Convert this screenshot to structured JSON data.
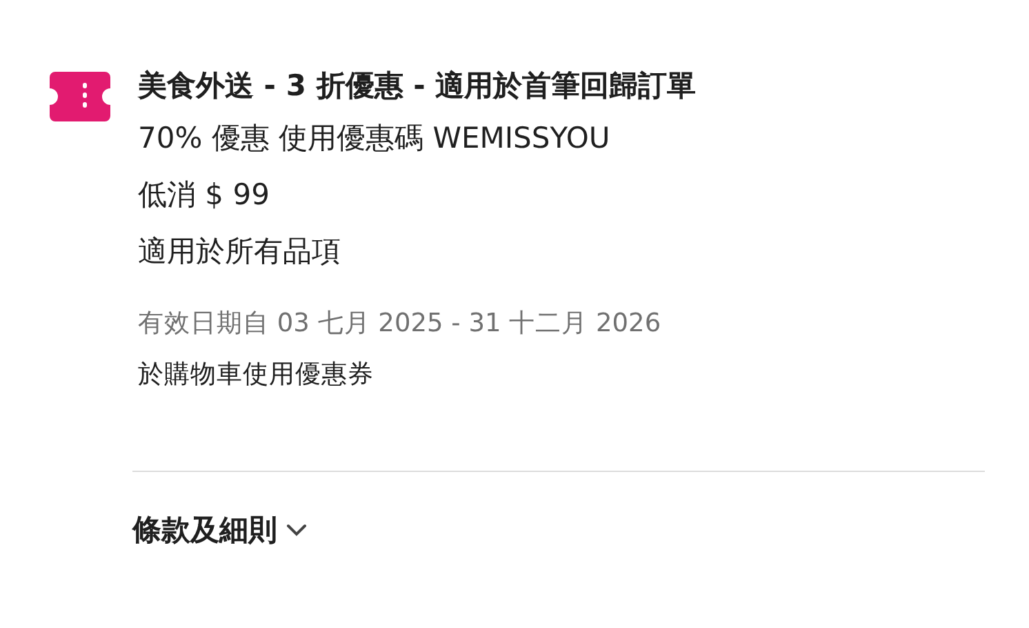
{
  "voucher": {
    "title": "美食外送 - 3 折優惠 - 適用於首筆回歸訂單",
    "details": [
      "70% 優惠 使用優惠碼 WEMISSYOU",
      "低消 $ 99",
      "適用於所有品項"
    ],
    "validity": "有效日期自 03 七月 2025 - 31 十二月 2026",
    "note": "於購物車使用優惠券"
  },
  "terms": {
    "label": "條款及細則",
    "expanded": false
  }
}
